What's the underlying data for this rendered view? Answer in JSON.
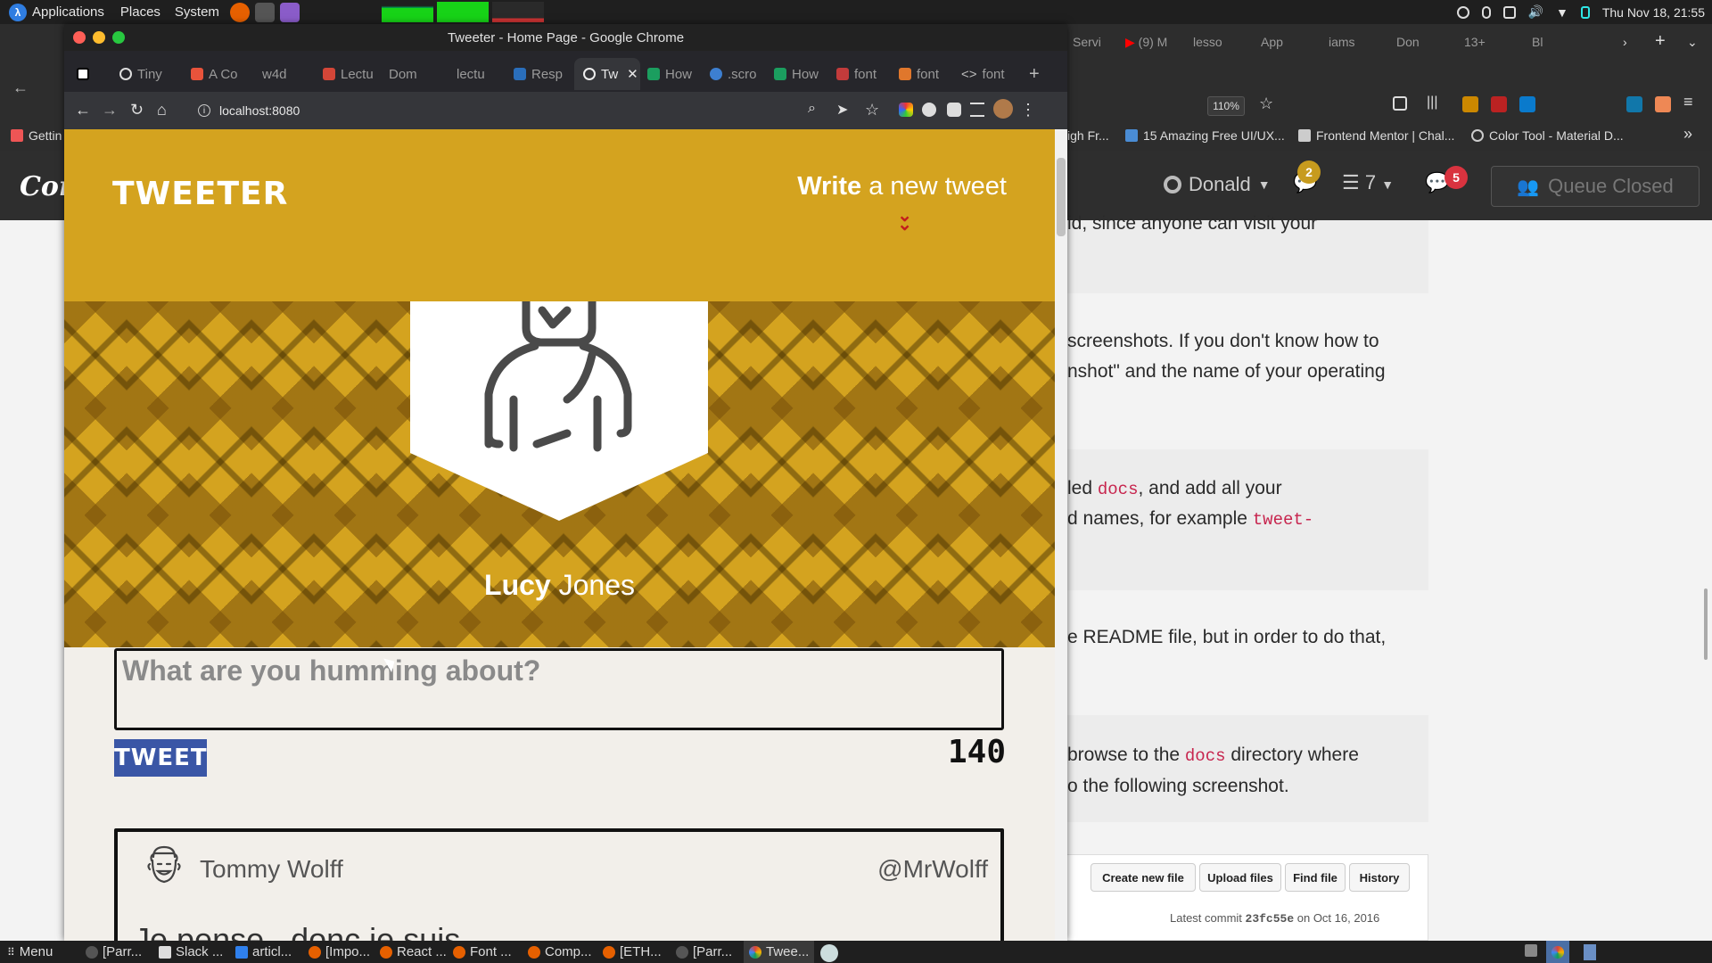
{
  "system_panel": {
    "applications": "Applications",
    "places": "Places",
    "system": "System",
    "clock": "Thu Nov 18, 21:55"
  },
  "chrome": {
    "window_title": "Tweeter - Home Page - Google Chrome",
    "url": "localhost:8080",
    "tabs": [
      {
        "label": "Tiny",
        "color": "#9a9a9a"
      },
      {
        "label": "A Co",
        "color": "#e8533b"
      },
      {
        "label": "w4d",
        "color": "#888"
      },
      {
        "label": "Lectu",
        "color": "#d44638"
      },
      {
        "label": "Dom",
        "color": "#999"
      },
      {
        "label": "lectu",
        "color": "#999"
      },
      {
        "label": "Resp",
        "color": "#2a6ebb"
      },
      {
        "label": "Tw",
        "color": "#e8e8e8"
      },
      {
        "label": "How",
        "color": "#1b9e5f"
      },
      {
        "label": ".scro",
        "color": "#3d7fd1"
      },
      {
        "label": "How",
        "color": "#1b9e5f"
      },
      {
        "label": "font",
        "color": "#c23b3b"
      },
      {
        "label": "font",
        "color": "#e0772c"
      },
      {
        "label": "font",
        "color": "#999"
      }
    ]
  },
  "tweeter": {
    "brand": "TWEETER",
    "write_bold": "Write",
    "write_rest": " a new tweet",
    "first_name": "Lucy",
    "last_name": " Jones",
    "compose_placeholder": "What are you humming about?",
    "tweet_button": "TWEET",
    "counter": "140",
    "tweets": [
      {
        "author": "Tommy Wolff",
        "handle": "@MrWolff",
        "text": "Je pense , donc je suis"
      }
    ]
  },
  "background_window": {
    "tabs": [
      "Servi",
      "(9) M",
      "lesso",
      "App",
      "iams",
      "Don",
      "13+",
      "Bl"
    ],
    "zoom": "110%",
    "bookmarks": [
      "Gettin",
      "igh Fr...",
      "15 Amazing Free UI/UX...",
      "Frontend Mentor | Chal...",
      "Color Tool - Material D..."
    ],
    "site_logo": "Com",
    "user": "Donald",
    "notif_count": "2",
    "list_count": "7",
    "msg_count": "5",
    "queue": "Queue Closed",
    "lines": [
      {
        "text": "id, since anyone can visit your"
      },
      {
        "text": "screenshots. If you don't know how to"
      },
      {
        "text": "nshot\" and the name of your operating"
      },
      {
        "pre": "led ",
        "code": "docs",
        "post": ", and add all your"
      },
      {
        "pre": "d names, for example ",
        "code": "tweet-",
        "post": ""
      },
      {
        "text": "e README file, but in order to do that,"
      },
      {
        "pre": "browse to the ",
        "code": "docs",
        "post": " directory where"
      },
      {
        "text": "o the following screenshot."
      }
    ],
    "gh_buttons": [
      "Create new file",
      "Upload files",
      "Find file",
      "History"
    ],
    "gh_commit_prefix": "Latest commit ",
    "gh_commit_hash": "23fc55e",
    "gh_commit_suffix": " on Oct 16, 2016"
  },
  "taskbar": {
    "menu": "Menu",
    "items": [
      "[Parr...",
      "Slack ...",
      "articl...",
      "[Impo...",
      "React ...",
      "Font ...",
      "Comp...",
      "[ETH...",
      "[Parr...",
      "Twee..."
    ]
  },
  "colors": {
    "tweeter_gold": "#d4a31f",
    "tweet_button_blue": "#3a56a6",
    "chevron_red": "#c21d1d",
    "page_bg": "#f2efea"
  }
}
